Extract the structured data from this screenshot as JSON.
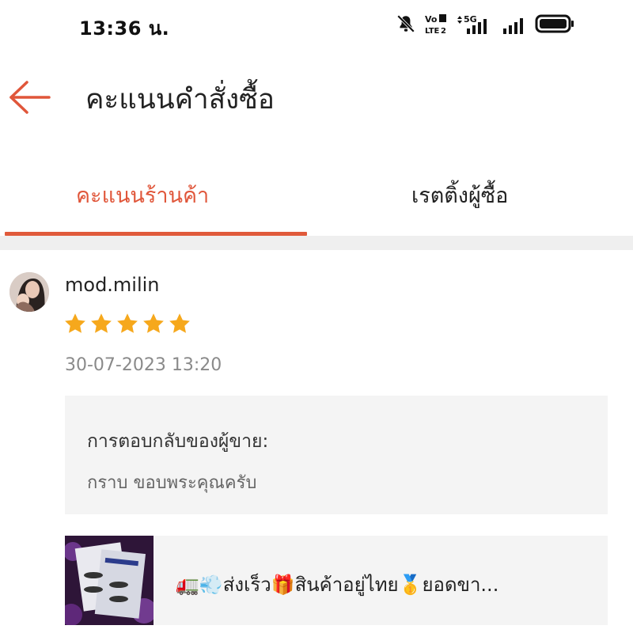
{
  "status_bar": {
    "time": "13:36 น.",
    "icons": [
      "mute-bell-icon",
      "volte-icon",
      "5g-signal-icon",
      "signal-icon",
      "battery-icon"
    ],
    "volte_top": "Vo",
    "volte_sub": "LTE",
    "volte_num": "2",
    "network": "5G"
  },
  "header": {
    "title": "คะแนนคำสั่งซื้อ",
    "back_icon": "back-arrow-icon"
  },
  "tabs": [
    {
      "label": "คะแนนร้านค้า",
      "active": true
    },
    {
      "label": "เรตติ้งผู้ซื้อ",
      "active": false
    }
  ],
  "review": {
    "username": "mod.milin",
    "rating": 5,
    "rating_max": 5,
    "timestamp": "30-07-2023 13:20",
    "seller_reply_label": "การตอบกลับของผู้ขาย:",
    "seller_reply_text": "กราบ ขอบพระคุณครับ"
  },
  "product": {
    "title": "🚛💨ส่งเร็ว🎁สินค้าอยู่ไทย🥇ยอดขา..."
  },
  "colors": {
    "accent": "#e0563a",
    "star": "#f6a81c",
    "separator": "#efefef",
    "card_bg": "#f4f4f4"
  }
}
